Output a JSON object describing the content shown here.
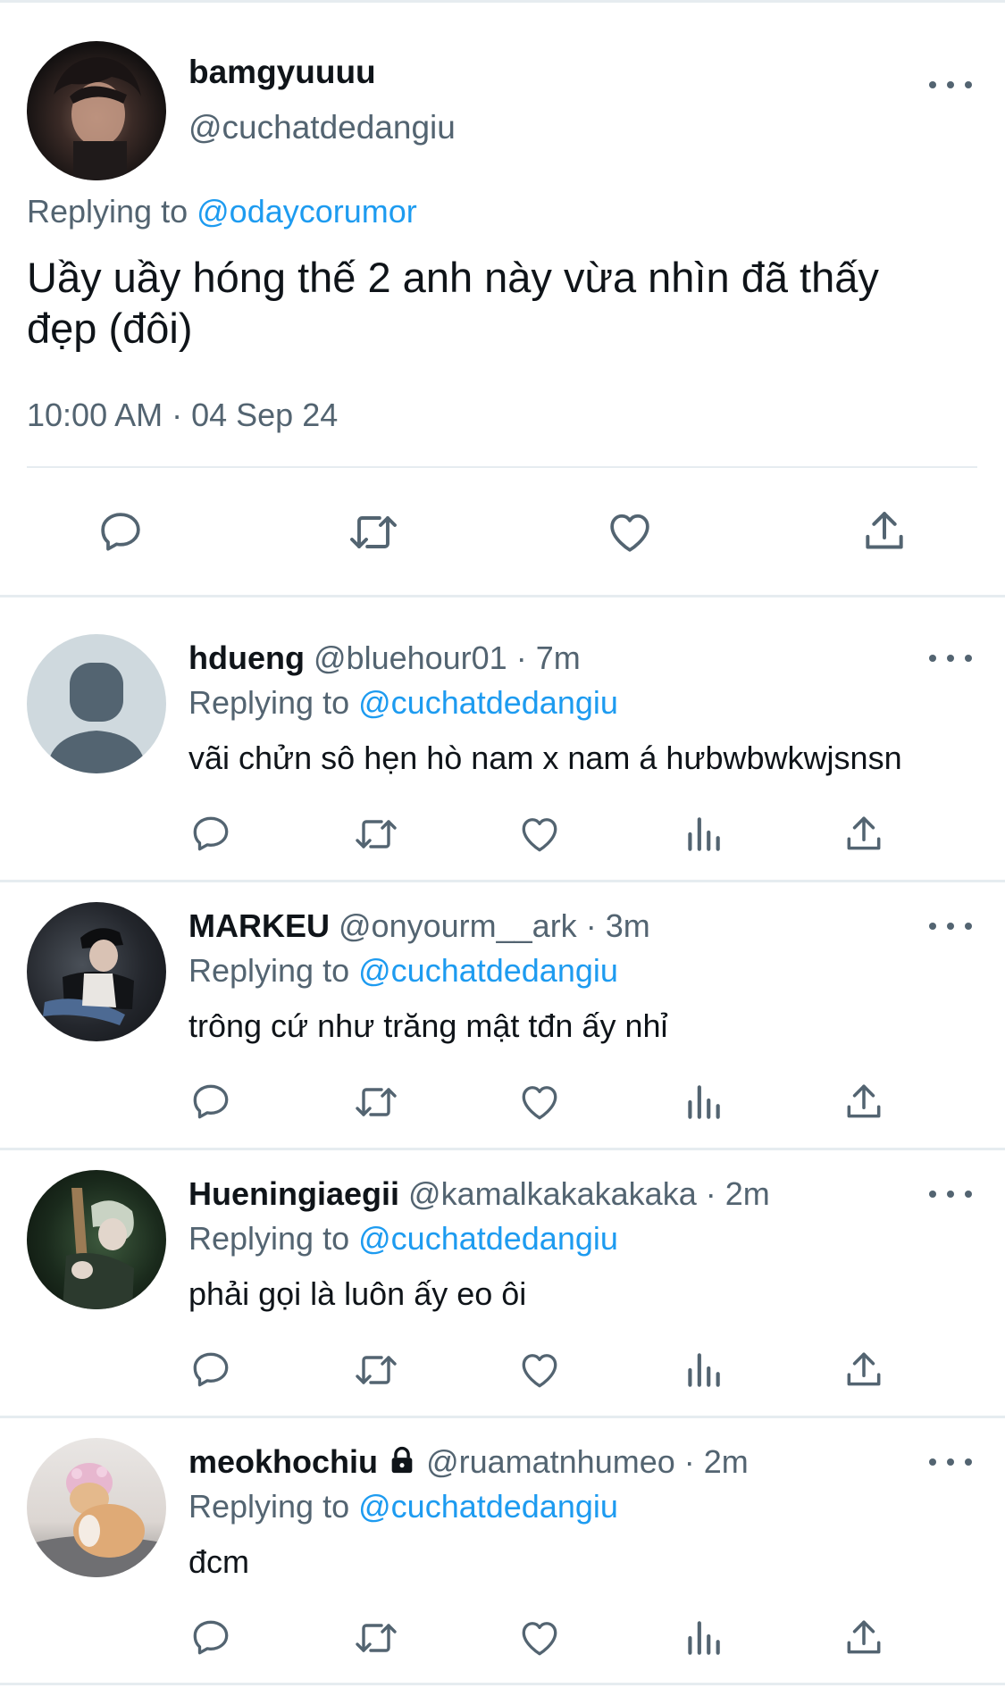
{
  "main_tweet": {
    "display_name": "bamgyuuuu",
    "handle": "@cuchatdedangiu",
    "replying_label": "Replying to",
    "replying_to": "@odaycorumor",
    "text_line1": "Uầy uầy hóng thế 2 anh này vừa nhìn đã thấy",
    "text_line2": "đẹp (đôi)",
    "timestamp": "10:00 AM · 04 Sep 24"
  },
  "replies": [
    {
      "display_name": "hdueng",
      "handle": "@bluehour01",
      "time": "· 7m",
      "replying_label": "Replying to",
      "replying_to": "@cuchatdedangiu",
      "text": "vãi chửn sô hẹn hò nam x nam á hưbwbwkwjsnsn"
    },
    {
      "display_name": "MARKEU",
      "handle": "@onyourm__ark",
      "time": "· 3m",
      "replying_label": "Replying to",
      "replying_to": "@cuchatdedangiu",
      "text": "trông cứ như trăng mật tđn ấy nhỉ"
    },
    {
      "display_name": "Hueningiaegii",
      "handle": "@kamalkakakakaka",
      "time": "· 2m",
      "replying_label": "Replying to",
      "replying_to": "@cuchatdedangiu",
      "text": "phải gọi là luôn ấy eo ôi"
    },
    {
      "display_name": "meokhochiu",
      "handle": "@ruamatnhumeo",
      "time": "· 2m",
      "replying_label": "Replying to",
      "replying_to": "@cuchatdedangiu",
      "text": "đcm"
    }
  ],
  "icons": {
    "more": "more-horizontal-icon",
    "reply": "comment-bubble-icon",
    "retweet": "retweet-arrows-icon",
    "like": "heart-outline-icon",
    "views": "analytics-bars-icon",
    "share": "share-upload-icon",
    "lock": "lock-icon"
  },
  "colors": {
    "link": "#1d9bf0",
    "muted": "#536471",
    "text": "#0f1419",
    "separator": "#e6ecf0"
  }
}
